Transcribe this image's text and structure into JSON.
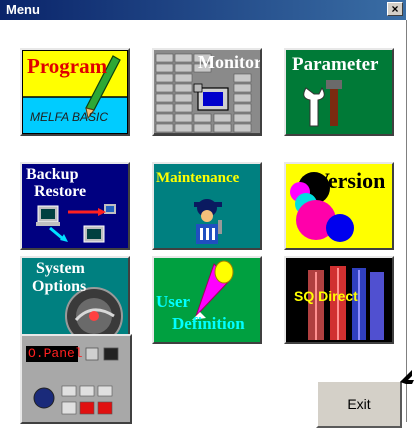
{
  "window": {
    "title": "Menu",
    "close_glyph": "×"
  },
  "tiles": {
    "program": {
      "title": "Program",
      "subtitle": "MELFA BASIC",
      "icon": "pencil-icon"
    },
    "monitor": {
      "title": "Monitor",
      "icon": "monitor-icon"
    },
    "parameter": {
      "title": "Parameter",
      "icon": "tools-icon"
    },
    "backup": {
      "line1": "Backup",
      "line2": "Restore",
      "icon": "computer-transfer-icon"
    },
    "maintenance": {
      "title": "Maintenance",
      "icon": "worker-icon"
    },
    "version": {
      "title": "Version",
      "icon": "circles-icon"
    },
    "system": {
      "line1": "System",
      "line2": "Options",
      "icon": "dial-icon"
    },
    "user": {
      "line1": "User",
      "line2": "Definition",
      "icon": "cone-icon"
    },
    "sq": {
      "title": "SQ Direct",
      "icon": "bars-icon"
    },
    "panel": {
      "display": "O.Panel",
      "icon": "operation-panel-icon"
    }
  },
  "exit_label": "Exit",
  "colors": {
    "titlebar": "#0a246a",
    "program_top": "#ffff00",
    "program_bottom": "#00ccff",
    "parameter_bg": "#007a37",
    "backup_bg": "#000080",
    "maintenance_bg": "#008080",
    "version_bg": "#ffff00",
    "system_bg": "#008080",
    "user_bg": "#00a040",
    "sq_bg": "#000000"
  }
}
